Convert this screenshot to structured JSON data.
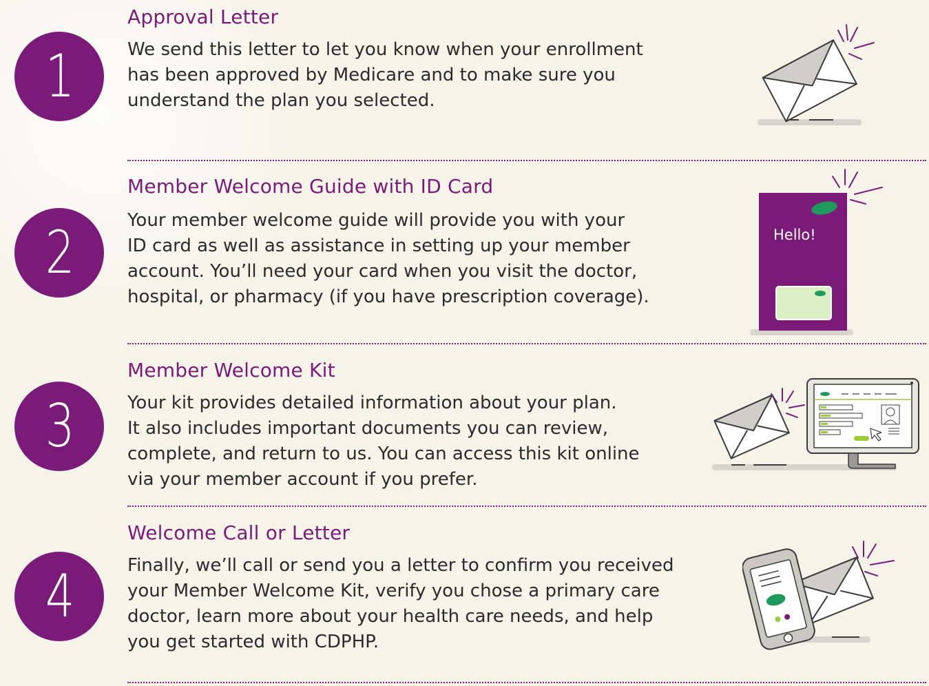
{
  "steps": [
    {
      "number": "1",
      "title": "Approval Letter",
      "body": [
        "We send this letter to let you know when your enrollment",
        "has been approved by Medicare and to make sure you",
        "understand the plan you selected."
      ]
    },
    {
      "number": "2",
      "title": "Member Welcome Guide with ID Card",
      "body": [
        "Your member welcome guide will provide you with your",
        "ID card as well as assistance in setting up your member",
        "account. You’ll need your card when you visit the doctor,",
        "hospital, or pharmacy (if you have prescription coverage)."
      ],
      "guide_text": "Hello!"
    },
    {
      "number": "3",
      "title": "Member Welcome Kit",
      "body": [
        "Your kit provides detailed information about your plan.",
        "It also includes important documents you can review,",
        "complete, and return to us. You can access this kit online",
        "via your member account if you prefer."
      ]
    },
    {
      "number": "4",
      "title": "Welcome Call or Letter",
      "body": [
        "Finally, we’ll call or send you a letter to confirm you received",
        "your Member Welcome Kit, verify you chose a primary care",
        "doctor, learn more about your health care needs, and help",
        "you get started with CDPHP."
      ]
    }
  ],
  "icons": {
    "step1": "envelope-icon",
    "step2": "welcome-guide-icon",
    "step3": "envelope-computer-icon",
    "step4": "phone-envelope-icon"
  },
  "colors": {
    "purple": "#7a1b7a",
    "green": "#1f9a5a",
    "lime": "#9ccc3a",
    "pale_green": "#dcefc4",
    "gray_fill": "#cfcfc7",
    "line": "#3a3a3a",
    "background": "#f6f3e8"
  }
}
